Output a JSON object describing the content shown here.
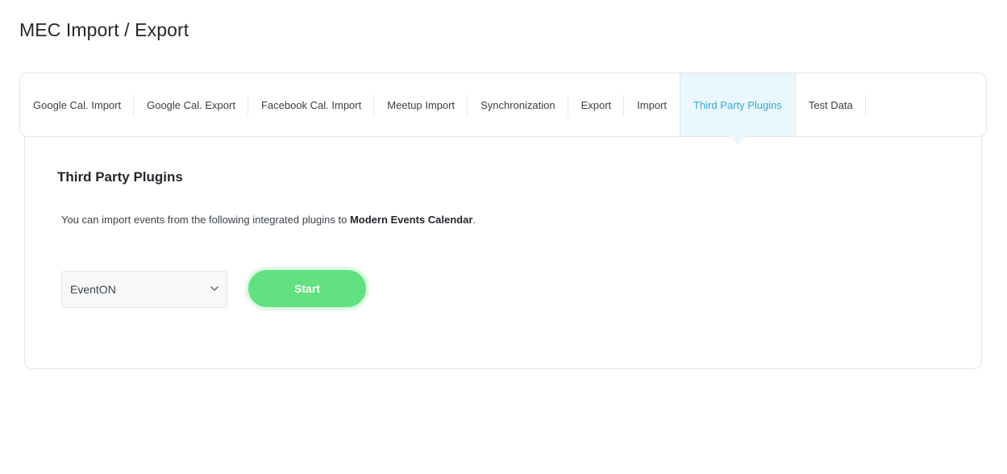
{
  "page": {
    "title": "MEC Import / Export"
  },
  "tabs": [
    {
      "label": "Google Cal. Import"
    },
    {
      "label": "Google Cal. Export"
    },
    {
      "label": "Facebook Cal. Import"
    },
    {
      "label": "Meetup Import"
    },
    {
      "label": "Synchronization"
    },
    {
      "label": "Export"
    },
    {
      "label": "Import"
    },
    {
      "label": "Third Party Plugins",
      "active": true
    },
    {
      "label": "Test Data"
    }
  ],
  "section": {
    "title": "Third Party Plugins",
    "description_prefix": "You can import events from the following integrated plugins to ",
    "description_bold": "Modern Events Calendar",
    "description_suffix": "."
  },
  "plugin_select": {
    "selected": "EventON",
    "icon": "chevron-down-icon"
  },
  "start_button": {
    "label": "Start"
  },
  "colors": {
    "active_tab_bg": "#eaf7fd",
    "active_tab_text": "#36a9d2",
    "start_button": "#61e17f"
  }
}
